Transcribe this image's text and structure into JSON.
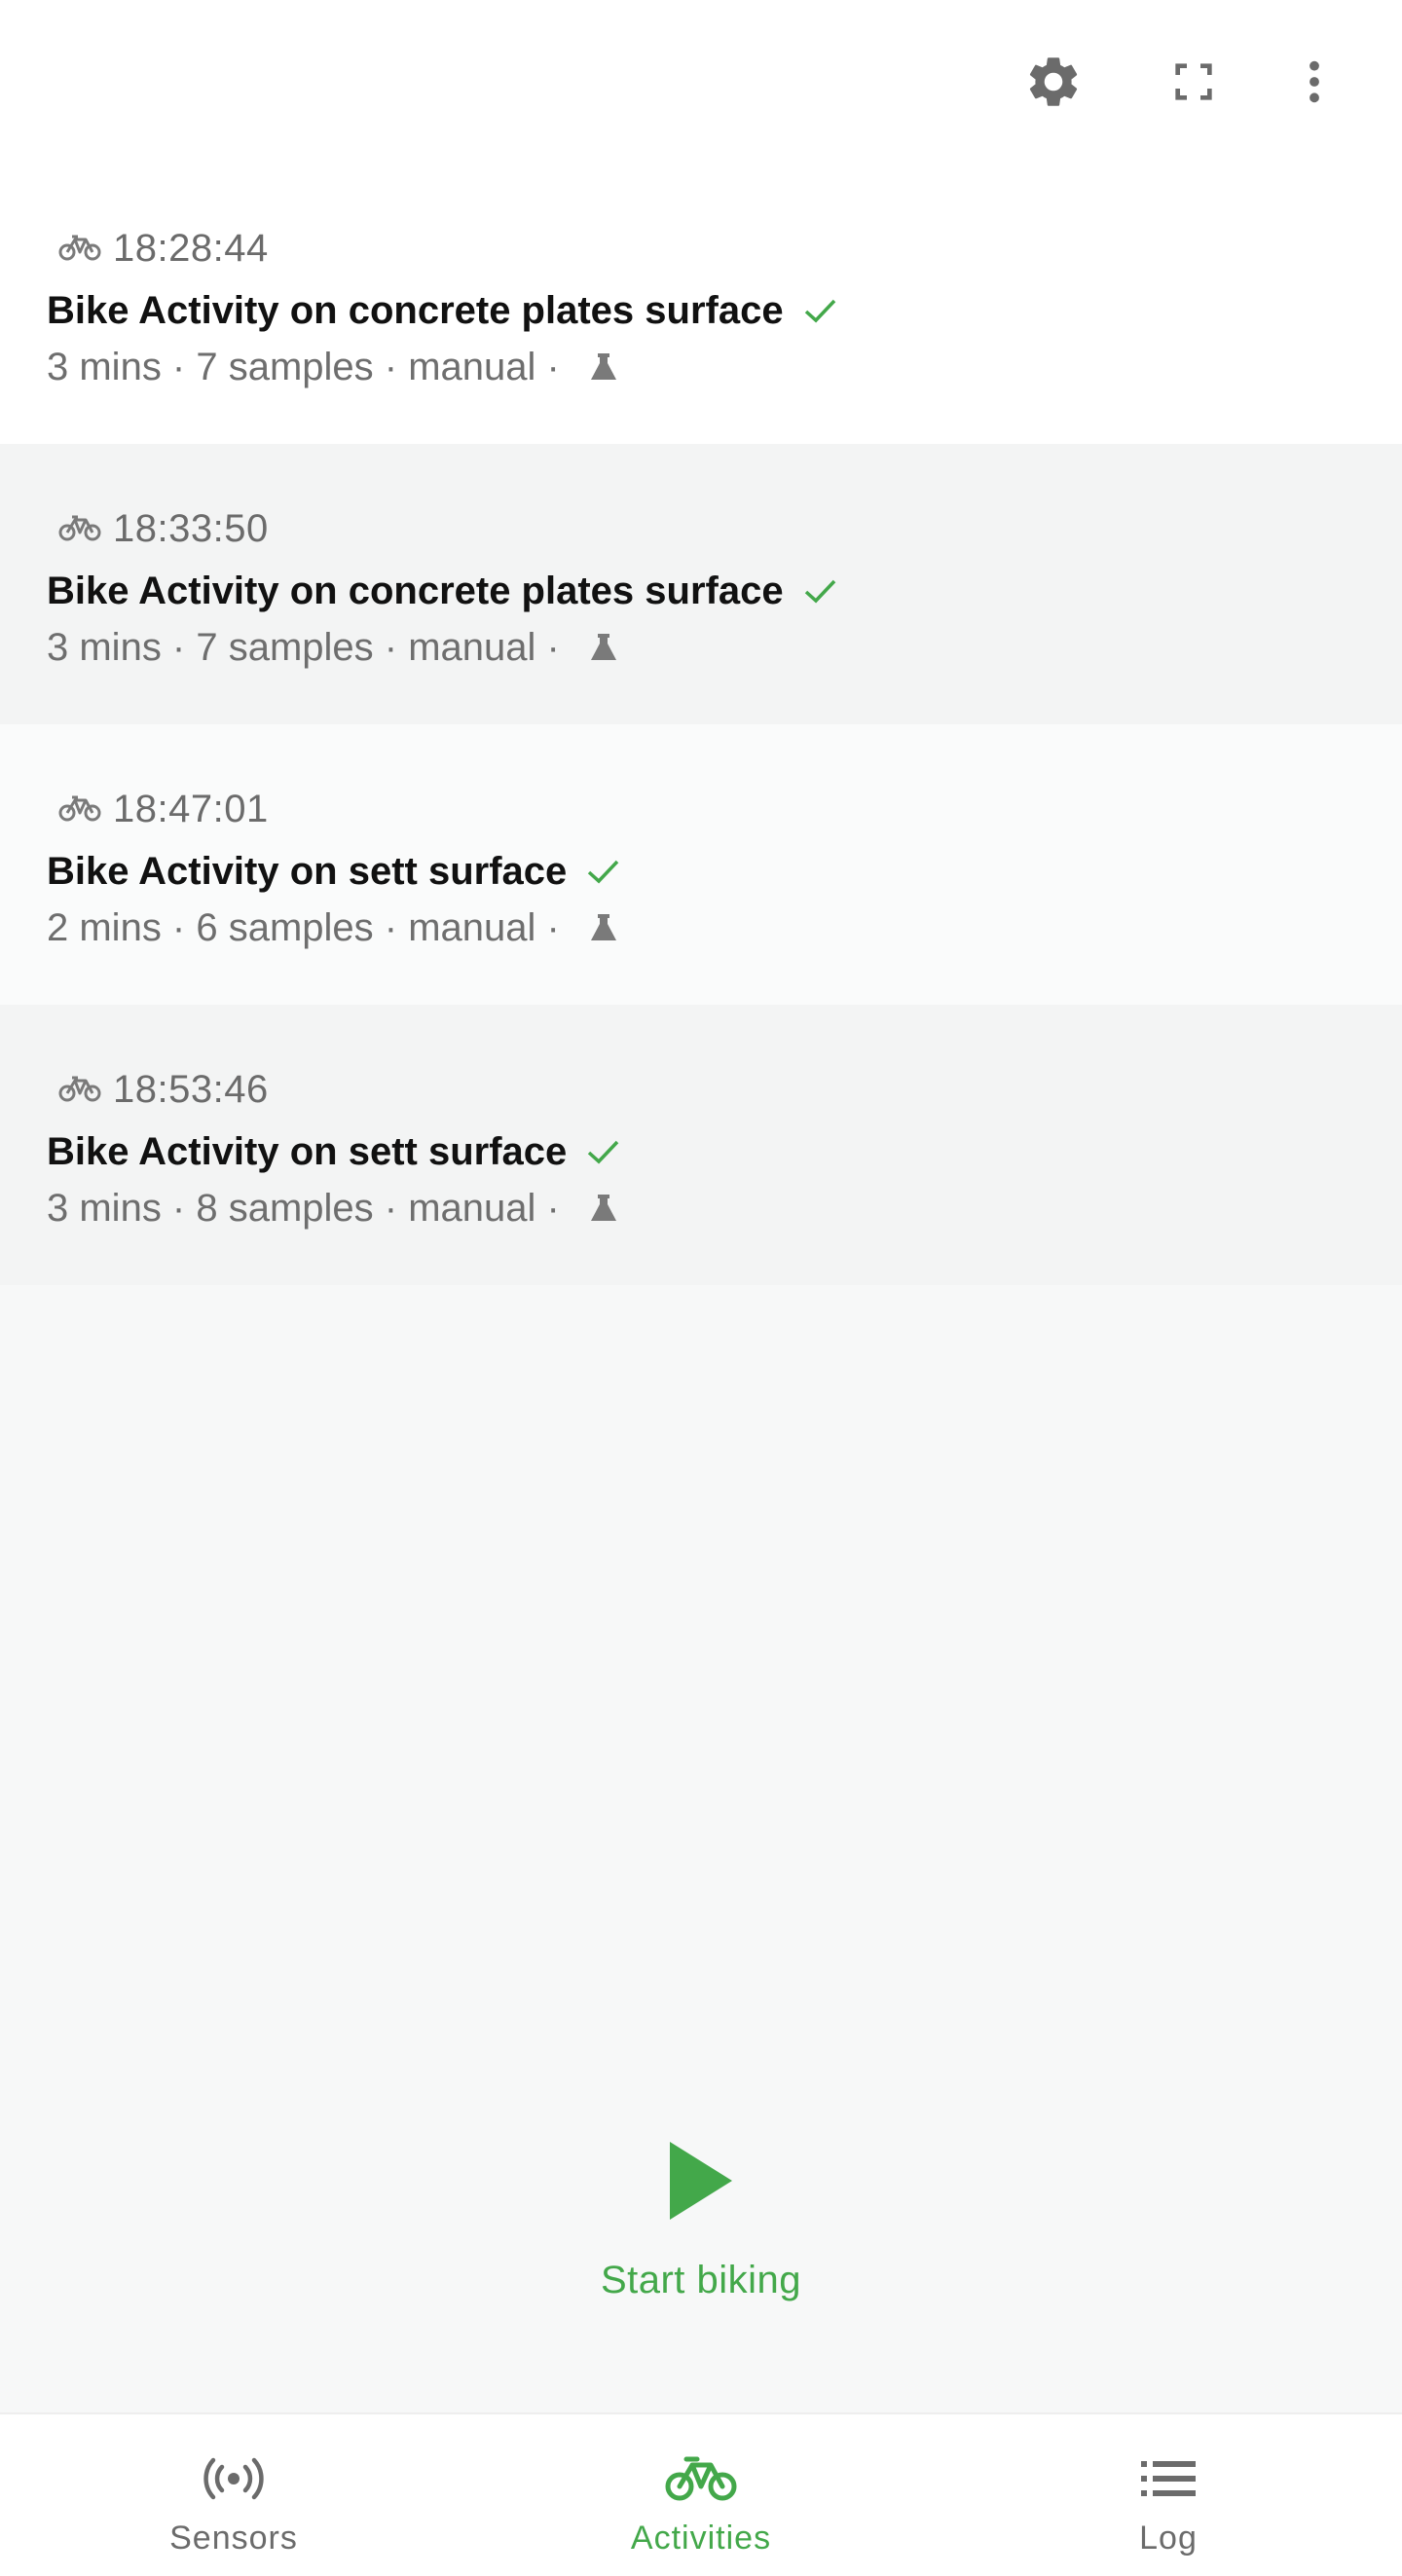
{
  "toolbar": {
    "settings_icon": "gear-icon",
    "fullscreen_icon": "fullscreen-icon",
    "menu_icon": "more-vert-icon"
  },
  "activities": [
    {
      "time": "18:28:44",
      "title": "Bike Activity on concrete plates surface",
      "meta": "3 mins · 7 samples · manual ·",
      "icon": "bike-icon",
      "status_icon": "check-icon",
      "tag_icon": "flask-icon"
    },
    {
      "time": "18:33:50",
      "title": "Bike Activity on concrete plates surface",
      "meta": "3 mins · 7 samples · manual ·",
      "icon": "bike-icon",
      "status_icon": "check-icon",
      "tag_icon": "flask-icon"
    },
    {
      "time": "18:47:01",
      "title": "Bike Activity on sett surface",
      "meta": "2 mins · 6 samples · manual ·",
      "icon": "bike-icon",
      "status_icon": "check-icon",
      "tag_icon": "flask-icon"
    },
    {
      "time": "18:53:46",
      "title": "Bike Activity on sett surface",
      "meta": "3 mins · 8 samples · manual ·",
      "icon": "bike-icon",
      "status_icon": "check-icon",
      "tag_icon": "flask-icon"
    }
  ],
  "start": {
    "label": "Start biking",
    "icon": "play-icon"
  },
  "bottom_nav": [
    {
      "label": "Sensors",
      "icon": "sensors-icon",
      "active": false
    },
    {
      "label": "Activities",
      "icon": "bike-icon",
      "active": true
    },
    {
      "label": "Log",
      "icon": "list-icon",
      "active": false
    }
  ],
  "colors": {
    "accent": "#43a84a",
    "text_primary": "#111111",
    "text_secondary": "#6e6e6e",
    "icon_grey": "#6b6b6b"
  }
}
